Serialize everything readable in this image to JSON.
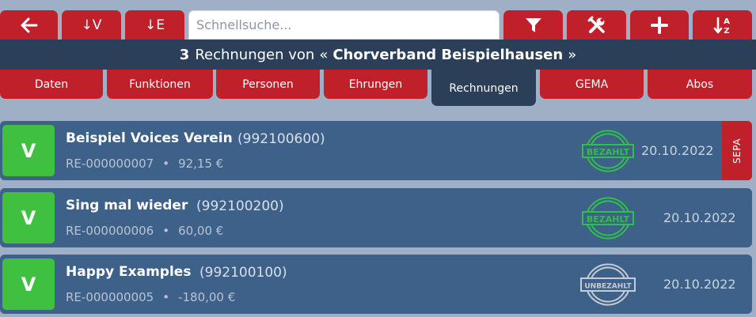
{
  "toolbar": {
    "back_icon": "arrow-left-icon",
    "sort_v_label": "↓V",
    "sort_e_label": "↓E",
    "search_placeholder": "Schnellsuche...",
    "filter_icon": "filter-icon",
    "tools_icon": "tools-icon",
    "add_icon": "plus-icon",
    "sort_az_icon": "sort-az-icon",
    "sort_az_top": "A",
    "sort_az_bottom": "Z"
  },
  "header": {
    "count": "3",
    "text_before": "Rechnungen von",
    "quote_open": "«",
    "organization": "Chorverband Beispielhausen",
    "quote_close": "»"
  },
  "tabs": [
    {
      "label": "Daten"
    },
    {
      "label": "Funktionen"
    },
    {
      "label": "Personen"
    },
    {
      "label": "Ehrungen"
    },
    {
      "label": "Rechnungen",
      "active": true
    },
    {
      "label": "GEMA"
    },
    {
      "label": "Abos"
    }
  ],
  "invoices": [
    {
      "badge": "V",
      "name": "Beispiel Voices Verein",
      "member_number": "(992100600)",
      "invoice_number": "RE-000000007",
      "separator": "•",
      "amount": "92,15 €",
      "status": "BEZAHLT",
      "status_color": "#2ec04a",
      "date": "20.10.2022",
      "sepa": "SEPA"
    },
    {
      "badge": "V",
      "name": "Sing mal wieder",
      "member_number": "(992100200)",
      "invoice_number": "RE-000000006",
      "separator": "•",
      "amount": "60,00 €",
      "status": "BEZAHLT",
      "status_color": "#2ec04a",
      "date": "20.10.2022"
    },
    {
      "badge": "V",
      "name": "Happy Examples",
      "member_number": "(992100100)",
      "invoice_number": "RE-000000005",
      "separator": "•",
      "amount": "-180,00 €",
      "status": "UNBEZAHLT",
      "status_color": "#c4ccd6",
      "date": "20.10.2022"
    }
  ],
  "colors": {
    "page_bg": "#9fb0c6",
    "accent_red": "#c0202a",
    "header_navy": "#2b3f59",
    "card_blue": "#3e6189",
    "badge_green": "#40c040"
  }
}
